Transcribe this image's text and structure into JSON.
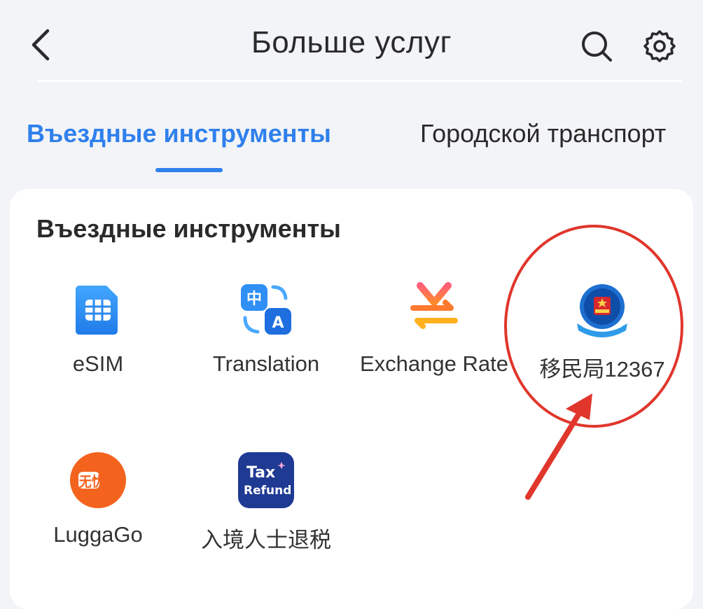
{
  "header": {
    "title": "Больше услуг"
  },
  "tabs": [
    {
      "label": "Въездные инструменты",
      "active": true
    },
    {
      "label": "Городской транспорт",
      "active": false
    }
  ],
  "section": {
    "title": "Въездные инструменты",
    "tools": [
      {
        "label": "eSIM",
        "icon": "sim-card-icon"
      },
      {
        "label": "Translation",
        "icon": "translate-icon"
      },
      {
        "label": "Exchange Rate",
        "icon": "yuan-exchange-icon"
      },
      {
        "label": "移民局12367",
        "icon": "immigration-emblem-icon"
      },
      {
        "label": "LuggaGo",
        "icon": "luggago-logo-icon",
        "logo_text": "无忧存"
      },
      {
        "label": "入境人士退税",
        "icon": "tax-refund-icon",
        "logo_text": [
          "Tax",
          "Refund"
        ]
      }
    ]
  },
  "colors": {
    "accent": "#2f80ed",
    "annotation": "#e0362c",
    "luggago": "#f3631e",
    "tax_refund": "#1f3a93"
  }
}
